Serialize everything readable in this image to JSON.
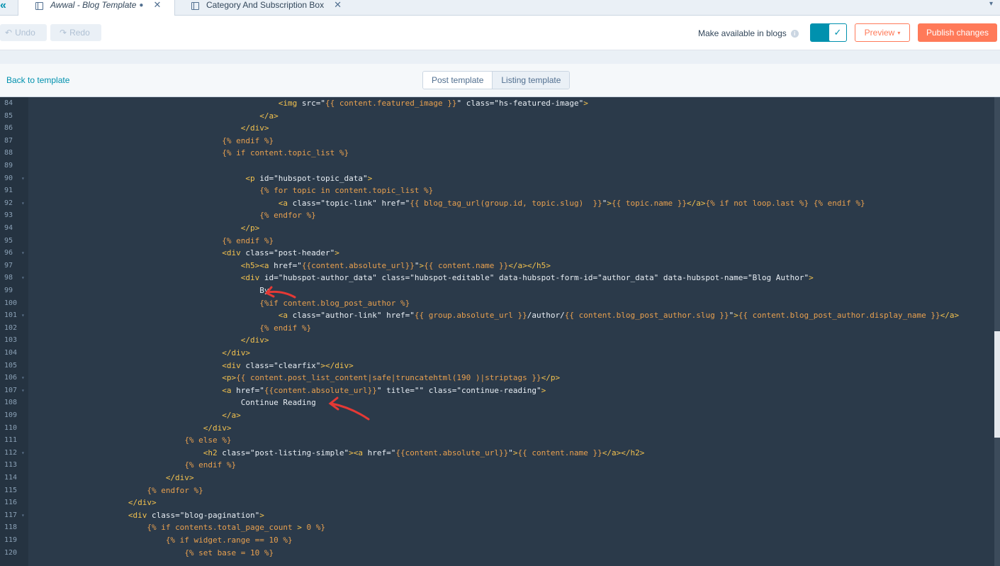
{
  "tabs": [
    {
      "title": "Awwal - Blog Template",
      "modified_marker": "●",
      "close": "✕"
    },
    {
      "title": "Category And Subscription Box",
      "close": "✕"
    }
  ],
  "tabbar": {
    "collapse_icon": "«",
    "dropdown_icon": "▾"
  },
  "toolbar": {
    "undo_label": "Undo",
    "redo_label": "Redo",
    "make_available_label": "Make available in blogs",
    "info_icon": "i",
    "toggle_checked": true,
    "toggle_check": "✓",
    "preview_label": "Preview",
    "preview_caret": "▾",
    "publish_label": "Publish changes"
  },
  "subbar": {
    "back_label": "Back to template",
    "segments": [
      "Post template",
      "Listing template"
    ]
  },
  "colors": {
    "accent": "#0091ae",
    "brand_orange": "#ff7a59",
    "editor_bg": "#2b3a4a",
    "annotation_red": "#e53935"
  },
  "editor": {
    "lines": [
      {
        "n": "84",
        "fold": false,
        "code": "                                                   <img src=\"{{ content.featured_image }}\" class=\"hs-featured-image\">"
      },
      {
        "n": "85",
        "fold": false,
        "code": "                                               </a>"
      },
      {
        "n": "86",
        "fold": false,
        "code": "                                           </div>"
      },
      {
        "n": "87",
        "fold": false,
        "code": "                                       {% endif %}"
      },
      {
        "n": "88",
        "fold": false,
        "code": "                                       {% if content.topic_list %}"
      },
      {
        "n": "89",
        "fold": false,
        "code": ""
      },
      {
        "n": "90",
        "fold": true,
        "code": "                                            <p id=\"hubspot-topic_data\">"
      },
      {
        "n": "91",
        "fold": false,
        "code": "                                               {% for topic in content.topic_list %}"
      },
      {
        "n": "92",
        "fold": true,
        "code": "                                                   <a class=\"topic-link\" href=\"{{ blog_tag_url(group.id, topic.slug)  }}\">{{ topic.name }}</a>{% if not loop.last %} {% endif %}"
      },
      {
        "n": "93",
        "fold": false,
        "code": "                                               {% endfor %}"
      },
      {
        "n": "94",
        "fold": false,
        "code": "                                           </p>"
      },
      {
        "n": "95",
        "fold": false,
        "code": "                                       {% endif %}"
      },
      {
        "n": "96",
        "fold": true,
        "code": "                                       <div class=\"post-header\">"
      },
      {
        "n": "97",
        "fold": false,
        "code": "                                           <h5><a href=\"{{content.absolute_url}}\">{{ content.name }}</a></h5>"
      },
      {
        "n": "98",
        "fold": true,
        "code": "                                           <div id=\"hubspot-author_data\" class=\"hubspot-editable\" data-hubspot-form-id=\"author_data\" data-hubspot-name=\"Blog Author\">"
      },
      {
        "n": "99",
        "fold": false,
        "code": "                                               By"
      },
      {
        "n": "100",
        "fold": false,
        "code": "                                               {%if content.blog_post_author %}"
      },
      {
        "n": "101",
        "fold": true,
        "code": "                                                   <a class=\"author-link\" href=\"{{ group.absolute_url }}/author/{{ content.blog_post_author.slug }}\">{{ content.blog_post_author.display_name }}</a>"
      },
      {
        "n": "102",
        "fold": false,
        "code": "                                               {% endif %}"
      },
      {
        "n": "103",
        "fold": false,
        "code": "                                           </div>"
      },
      {
        "n": "104",
        "fold": false,
        "code": "                                       </div>"
      },
      {
        "n": "105",
        "fold": false,
        "code": "                                       <div class=\"clearfix\"></div>"
      },
      {
        "n": "106",
        "fold": true,
        "code": "                                       <p>{{ content.post_list_content|safe|truncatehtml(190 )|striptags }}</p>"
      },
      {
        "n": "107",
        "fold": true,
        "code": "                                       <a href=\"{{content.absolute_url}}\" title=\"\" class=\"continue-reading\">"
      },
      {
        "n": "108",
        "fold": false,
        "code": "                                           Continue Reading"
      },
      {
        "n": "109",
        "fold": false,
        "code": "                                       </a>"
      },
      {
        "n": "110",
        "fold": false,
        "code": "                                   </div>"
      },
      {
        "n": "111",
        "fold": false,
        "code": "                               {% else %}"
      },
      {
        "n": "112",
        "fold": true,
        "code": "                                   <h2 class=\"post-listing-simple\"><a href=\"{{content.absolute_url}}\">{{ content.name }}</a></h2>"
      },
      {
        "n": "113",
        "fold": false,
        "code": "                               {% endif %}"
      },
      {
        "n": "114",
        "fold": false,
        "code": "                           </div>"
      },
      {
        "n": "115",
        "fold": false,
        "code": "                       {% endfor %}"
      },
      {
        "n": "116",
        "fold": false,
        "code": "                   </div>"
      },
      {
        "n": "117",
        "fold": true,
        "code": "                   <div class=\"blog-pagination\">"
      },
      {
        "n": "118",
        "fold": false,
        "code": "                       {% if contents.total_page_count > 0 %}"
      },
      {
        "n": "119",
        "fold": false,
        "code": "                           {% if widget.range == 10 %}"
      },
      {
        "n": "120",
        "fold": false,
        "code": "                               {% set base = 10 %}"
      }
    ]
  }
}
